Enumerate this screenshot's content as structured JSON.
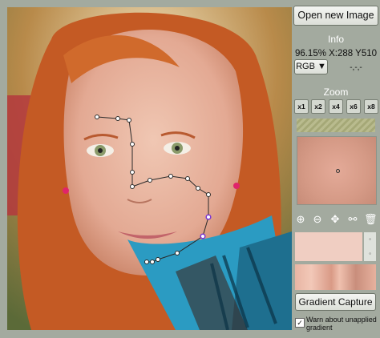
{
  "panel": {
    "open_button": "Open new Image",
    "info_title": "Info",
    "coords": "96.15% X:288 Y510",
    "color_mode": "RGB ▼",
    "color_values": "-,-,-",
    "zoom_title": "Zoom",
    "zoom_levels": [
      "x1",
      "x2",
      "x4",
      "x6",
      "x8"
    ],
    "gradient_button": "Gradient Capture",
    "warn_label": "Warn about unapplied gradient",
    "warn_checked": "✓"
  },
  "tools": {
    "icons": [
      "plus-circle-icon",
      "minus-circle-icon",
      "move-icon",
      "split-icon",
      "trash-icon"
    ]
  },
  "colors": {
    "background": "#a3aa9f",
    "accent_point": "#7a35d4"
  }
}
